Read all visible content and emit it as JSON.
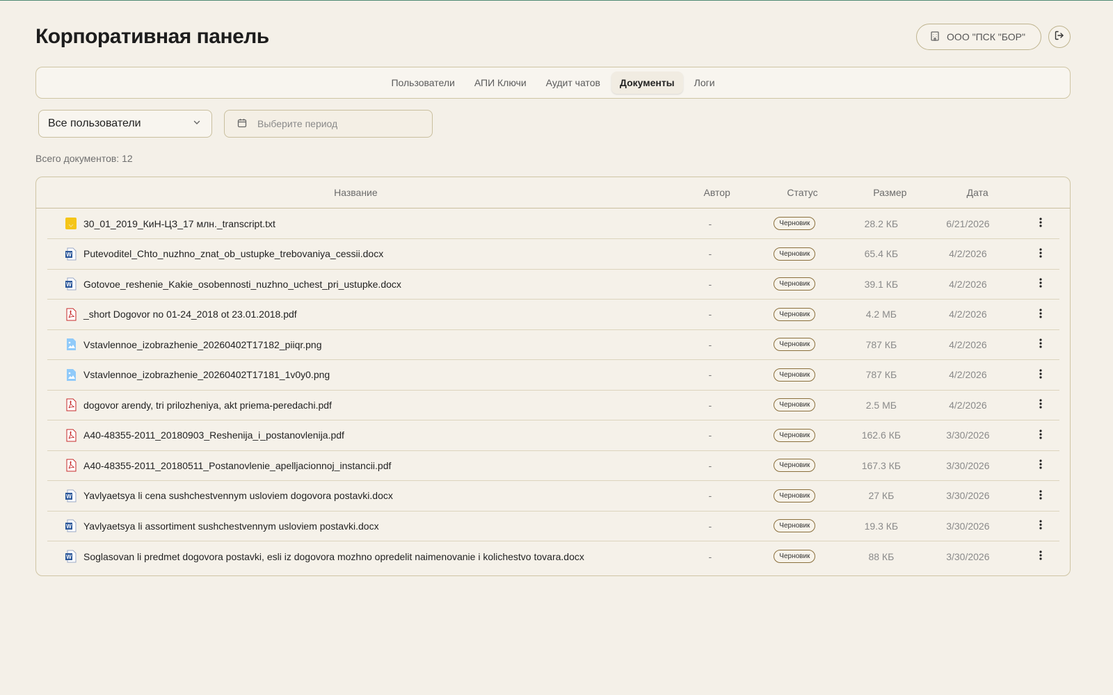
{
  "page": {
    "title": "Корпоративная панель",
    "org_label": "ООО \"ПСК \"БОР\"",
    "icons": {
      "org": "building-icon",
      "logout": "logout-icon"
    }
  },
  "tabs": [
    {
      "label": "Пользователи",
      "active": false
    },
    {
      "label": "АПИ Ключи",
      "active": false
    },
    {
      "label": "Аудит чатов",
      "active": false
    },
    {
      "label": "Документы",
      "active": true
    },
    {
      "label": "Логи",
      "active": false
    }
  ],
  "filters": {
    "user_select_value": "Все пользователи",
    "period_placeholder": "Выберите период"
  },
  "summary": {
    "doc_count_text": "Всего документов: 12"
  },
  "table": {
    "headers": {
      "name": "Название",
      "author": "Автор",
      "status": "Статус",
      "size": "Размер",
      "date": "Дата"
    },
    "rows": [
      {
        "icon": "txt-file-icon",
        "name": "30_01_2019_КиН-ЦЗ_17 млн._transcript.txt",
        "author": "-",
        "status": "Черновик",
        "size": "28.2 КБ",
        "date": "6/21/2026"
      },
      {
        "icon": "word-file-icon",
        "name": "Putevoditel_Chto_nuzhno_znat_ob_ustupke_trebovaniya_cessii.docx",
        "author": "-",
        "status": "Черновик",
        "size": "65.4 КБ",
        "date": "4/2/2026"
      },
      {
        "icon": "word-file-icon",
        "name": "Gotovoe_reshenie_Kakie_osobennosti_nuzhno_uchest_pri_ustupke.docx",
        "author": "-",
        "status": "Черновик",
        "size": "39.1 КБ",
        "date": "4/2/2026"
      },
      {
        "icon": "pdf-file-icon",
        "name": "_short Dogovor no 01-24_2018 ot 23.01.2018.pdf",
        "author": "-",
        "status": "Черновик",
        "size": "4.2 МБ",
        "date": "4/2/2026"
      },
      {
        "icon": "image-file-icon",
        "name": "Vstavlennoe_izobrazhenie_20260402T17182_piiqr.png",
        "author": "-",
        "status": "Черновик",
        "size": "787 КБ",
        "date": "4/2/2026"
      },
      {
        "icon": "image-file-icon",
        "name": "Vstavlennoe_izobrazhenie_20260402T17181_1v0y0.png",
        "author": "-",
        "status": "Черновик",
        "size": "787 КБ",
        "date": "4/2/2026"
      },
      {
        "icon": "pdf-file-icon",
        "name": "dogovor arendy, tri prilozheniya, akt priema-peredachi.pdf",
        "author": "-",
        "status": "Черновик",
        "size": "2.5 МБ",
        "date": "4/2/2026"
      },
      {
        "icon": "pdf-file-icon",
        "name": "A40-48355-2011_20180903_Reshenija_i_postanovlenija.pdf",
        "author": "-",
        "status": "Черновик",
        "size": "162.6 КБ",
        "date": "3/30/2026"
      },
      {
        "icon": "pdf-file-icon",
        "name": "A40-48355-2011_20180511_Postanovlenie_apelljacionnoj_instancii.pdf",
        "author": "-",
        "status": "Черновик",
        "size": "167.3 КБ",
        "date": "3/30/2026"
      },
      {
        "icon": "word-file-icon",
        "name": "Yavlyaetsya li cena sushchestvennym usloviem dogovora postavki.docx",
        "author": "-",
        "status": "Черновик",
        "size": "27 КБ",
        "date": "3/30/2026"
      },
      {
        "icon": "word-file-icon",
        "name": "Yavlyaetsya li assortiment sushchestvennym usloviem postavki.docx",
        "author": "-",
        "status": "Черновик",
        "size": "19.3 КБ",
        "date": "3/30/2026"
      },
      {
        "icon": "word-file-icon",
        "name": "Soglasovan li predmet dogovora postavki, esli iz dogovora mozhno opredelit naimenovanie i kolichestvo tovara.docx",
        "author": "-",
        "status": "Черновик",
        "size": "88 КБ",
        "date": "3/30/2026"
      }
    ]
  },
  "colors": {
    "background": "#f4f0e8",
    "border": "#cfc5a4",
    "badge_border": "#8a6f3c",
    "word_blue": "#2b579a",
    "pdf_red": "#c62828",
    "txt_yellow": "#f5c518",
    "image_blue": "#64b5f6"
  }
}
